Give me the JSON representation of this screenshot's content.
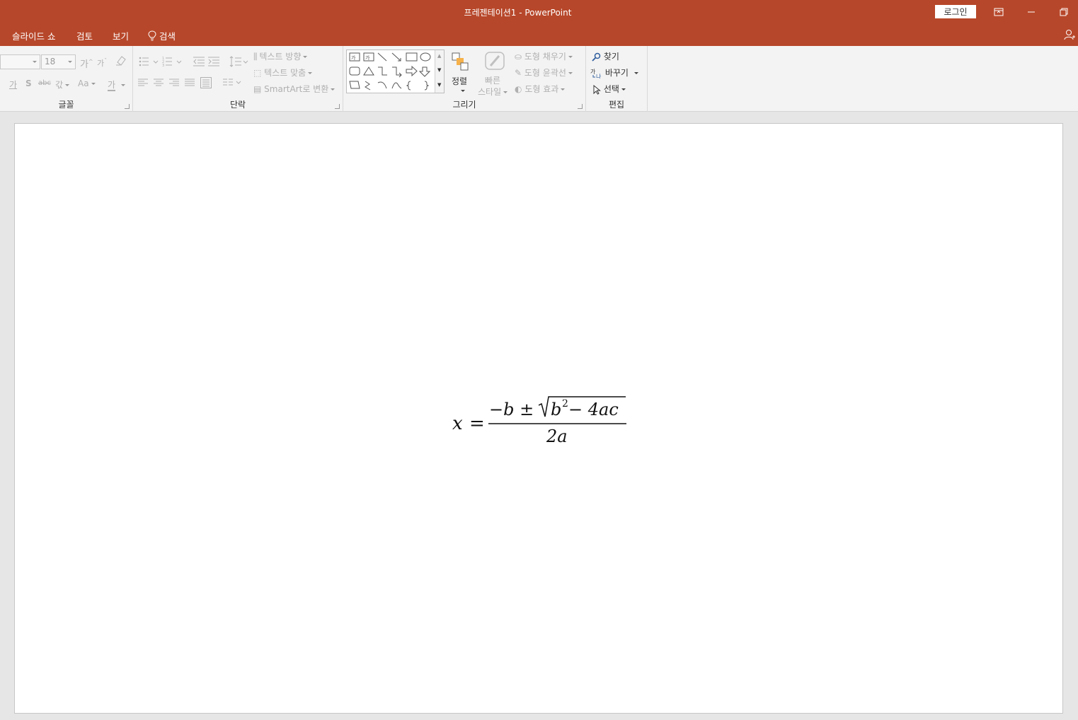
{
  "window": {
    "title": "프레젠테이션1  -  PowerPoint",
    "login_label": "로그인"
  },
  "menu": {
    "items": [
      "슬라이드 쇼",
      "검토",
      "보기"
    ],
    "search_label": "검색"
  },
  "ribbon": {
    "font": {
      "label": "글꼴",
      "font_name_value": "",
      "font_size_value": "18",
      "grow_label": "가",
      "shrink_label": "가",
      "italic_label": "가",
      "shadow_label": "S",
      "strike_label": "abc",
      "spacing_label": "갃",
      "case_label": "Aa",
      "color_label": "가"
    },
    "paragraph": {
      "label": "단락",
      "text_direction": "텍스트 방향",
      "align_text": "텍스트 맞춤",
      "smartart": "SmartArt로 변환"
    },
    "drawing": {
      "label": "그리기",
      "arrange": "정렬",
      "quick_styles_line1": "빠른",
      "quick_styles_line2": "스타일",
      "shape_fill": "도형 채우기",
      "shape_outline": "도형 윤곽선",
      "shape_effects": "도형 효과"
    },
    "editing": {
      "label": "편집",
      "find": "찾기",
      "replace": "바꾸기",
      "select": "선택"
    }
  },
  "slide": {
    "equation": {
      "lhs": "x",
      "equals": "=",
      "numerator_prefix": "−b ± ",
      "radicand_b": "b",
      "radicand_exp": "2",
      "radicand_rest": " − 4ac",
      "denominator": "2a"
    }
  }
}
